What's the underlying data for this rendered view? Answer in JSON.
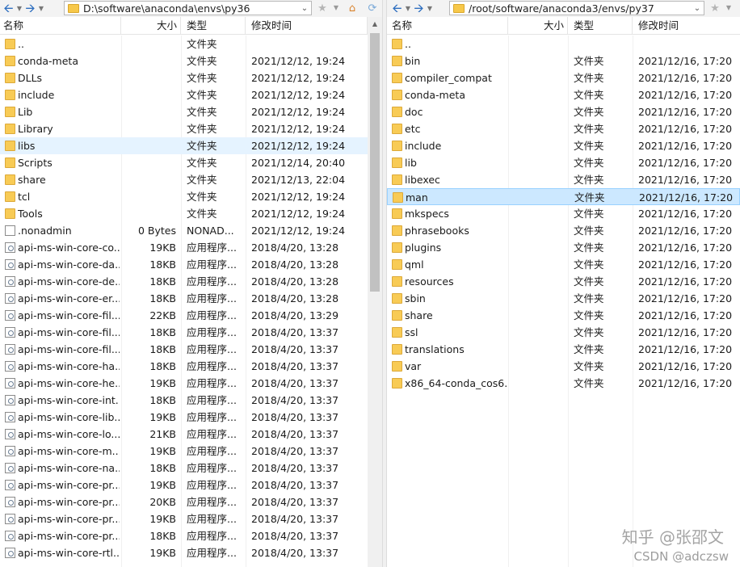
{
  "left": {
    "path": "D:\\software\\anaconda\\envs\\py36",
    "columns": {
      "name": "名称",
      "size": "大小",
      "type": "类型",
      "modified": "修改时间"
    },
    "rows": [
      {
        "name": "..",
        "size": "",
        "type": "文件夹",
        "modified": "",
        "icon": "folder"
      },
      {
        "name": "conda-meta",
        "size": "",
        "type": "文件夹",
        "modified": "2021/12/12, 19:24",
        "icon": "folder"
      },
      {
        "name": "DLLs",
        "size": "",
        "type": "文件夹",
        "modified": "2021/12/12, 19:24",
        "icon": "folder"
      },
      {
        "name": "include",
        "size": "",
        "type": "文件夹",
        "modified": "2021/12/12, 19:24",
        "icon": "folder"
      },
      {
        "name": "Lib",
        "size": "",
        "type": "文件夹",
        "modified": "2021/12/12, 19:24",
        "icon": "folder"
      },
      {
        "name": "Library",
        "size": "",
        "type": "文件夹",
        "modified": "2021/12/12, 19:24",
        "icon": "folder"
      },
      {
        "name": "libs",
        "size": "",
        "type": "文件夹",
        "modified": "2021/12/12, 19:24",
        "icon": "folder",
        "state": "hover"
      },
      {
        "name": "Scripts",
        "size": "",
        "type": "文件夹",
        "modified": "2021/12/14, 20:40",
        "icon": "folder"
      },
      {
        "name": "share",
        "size": "",
        "type": "文件夹",
        "modified": "2021/12/13, 22:04",
        "icon": "folder"
      },
      {
        "name": "tcl",
        "size": "",
        "type": "文件夹",
        "modified": "2021/12/12, 19:24",
        "icon": "folder"
      },
      {
        "name": "Tools",
        "size": "",
        "type": "文件夹",
        "modified": "2021/12/12, 19:24",
        "icon": "folder"
      },
      {
        "name": ".nonadmin",
        "size": "0 Bytes",
        "type": "NONAD...",
        "modified": "2021/12/12, 19:24",
        "icon": "file"
      },
      {
        "name": "api-ms-win-core-co...",
        "size": "19KB",
        "type": "应用程序...",
        "modified": "2018/4/20, 13:28",
        "icon": "dll"
      },
      {
        "name": "api-ms-win-core-da...",
        "size": "18KB",
        "type": "应用程序...",
        "modified": "2018/4/20, 13:28",
        "icon": "dll"
      },
      {
        "name": "api-ms-win-core-de...",
        "size": "18KB",
        "type": "应用程序...",
        "modified": "2018/4/20, 13:28",
        "icon": "dll"
      },
      {
        "name": "api-ms-win-core-er...",
        "size": "18KB",
        "type": "应用程序...",
        "modified": "2018/4/20, 13:28",
        "icon": "dll"
      },
      {
        "name": "api-ms-win-core-fil...",
        "size": "22KB",
        "type": "应用程序...",
        "modified": "2018/4/20, 13:29",
        "icon": "dll"
      },
      {
        "name": "api-ms-win-core-fil...",
        "size": "18KB",
        "type": "应用程序...",
        "modified": "2018/4/20, 13:37",
        "icon": "dll"
      },
      {
        "name": "api-ms-win-core-fil...",
        "size": "18KB",
        "type": "应用程序...",
        "modified": "2018/4/20, 13:37",
        "icon": "dll"
      },
      {
        "name": "api-ms-win-core-ha...",
        "size": "18KB",
        "type": "应用程序...",
        "modified": "2018/4/20, 13:37",
        "icon": "dll"
      },
      {
        "name": "api-ms-win-core-he...",
        "size": "19KB",
        "type": "应用程序...",
        "modified": "2018/4/20, 13:37",
        "icon": "dll"
      },
      {
        "name": "api-ms-win-core-int...",
        "size": "18KB",
        "type": "应用程序...",
        "modified": "2018/4/20, 13:37",
        "icon": "dll"
      },
      {
        "name": "api-ms-win-core-lib...",
        "size": "19KB",
        "type": "应用程序...",
        "modified": "2018/4/20, 13:37",
        "icon": "dll"
      },
      {
        "name": "api-ms-win-core-lo...",
        "size": "21KB",
        "type": "应用程序...",
        "modified": "2018/4/20, 13:37",
        "icon": "dll"
      },
      {
        "name": "api-ms-win-core-m...",
        "size": "19KB",
        "type": "应用程序...",
        "modified": "2018/4/20, 13:37",
        "icon": "dll"
      },
      {
        "name": "api-ms-win-core-na...",
        "size": "18KB",
        "type": "应用程序...",
        "modified": "2018/4/20, 13:37",
        "icon": "dll"
      },
      {
        "name": "api-ms-win-core-pr...",
        "size": "19KB",
        "type": "应用程序...",
        "modified": "2018/4/20, 13:37",
        "icon": "dll"
      },
      {
        "name": "api-ms-win-core-pr...",
        "size": "20KB",
        "type": "应用程序...",
        "modified": "2018/4/20, 13:37",
        "icon": "dll"
      },
      {
        "name": "api-ms-win-core-pr...",
        "size": "19KB",
        "type": "应用程序...",
        "modified": "2018/4/20, 13:37",
        "icon": "dll"
      },
      {
        "name": "api-ms-win-core-pr...",
        "size": "18KB",
        "type": "应用程序...",
        "modified": "2018/4/20, 13:37",
        "icon": "dll"
      },
      {
        "name": "api-ms-win-core-rtl...",
        "size": "19KB",
        "type": "应用程序...",
        "modified": "2018/4/20, 13:37",
        "icon": "dll"
      }
    ]
  },
  "right": {
    "path": "/root/software/anaconda3/envs/py37",
    "columns": {
      "name": "名称",
      "size": "大小",
      "type": "类型",
      "modified": "修改时间"
    },
    "rows": [
      {
        "name": "..",
        "size": "",
        "type": "",
        "modified": "",
        "icon": "folder"
      },
      {
        "name": "bin",
        "size": "",
        "type": "文件夹",
        "modified": "2021/12/16, 17:20",
        "icon": "folder"
      },
      {
        "name": "compiler_compat",
        "size": "",
        "type": "文件夹",
        "modified": "2021/12/16, 17:20",
        "icon": "folder"
      },
      {
        "name": "conda-meta",
        "size": "",
        "type": "文件夹",
        "modified": "2021/12/16, 17:20",
        "icon": "folder"
      },
      {
        "name": "doc",
        "size": "",
        "type": "文件夹",
        "modified": "2021/12/16, 17:20",
        "icon": "folder"
      },
      {
        "name": "etc",
        "size": "",
        "type": "文件夹",
        "modified": "2021/12/16, 17:20",
        "icon": "folder"
      },
      {
        "name": "include",
        "size": "",
        "type": "文件夹",
        "modified": "2021/12/16, 17:20",
        "icon": "folder"
      },
      {
        "name": "lib",
        "size": "",
        "type": "文件夹",
        "modified": "2021/12/16, 17:20",
        "icon": "folder"
      },
      {
        "name": "libexec",
        "size": "",
        "type": "文件夹",
        "modified": "2021/12/16, 17:20",
        "icon": "folder"
      },
      {
        "name": "man",
        "size": "",
        "type": "文件夹",
        "modified": "2021/12/16, 17:20",
        "icon": "folder",
        "state": "active"
      },
      {
        "name": "mkspecs",
        "size": "",
        "type": "文件夹",
        "modified": "2021/12/16, 17:20",
        "icon": "folder"
      },
      {
        "name": "phrasebooks",
        "size": "",
        "type": "文件夹",
        "modified": "2021/12/16, 17:20",
        "icon": "folder"
      },
      {
        "name": "plugins",
        "size": "",
        "type": "文件夹",
        "modified": "2021/12/16, 17:20",
        "icon": "folder"
      },
      {
        "name": "qml",
        "size": "",
        "type": "文件夹",
        "modified": "2021/12/16, 17:20",
        "icon": "folder"
      },
      {
        "name": "resources",
        "size": "",
        "type": "文件夹",
        "modified": "2021/12/16, 17:20",
        "icon": "folder"
      },
      {
        "name": "sbin",
        "size": "",
        "type": "文件夹",
        "modified": "2021/12/16, 17:20",
        "icon": "folder"
      },
      {
        "name": "share",
        "size": "",
        "type": "文件夹",
        "modified": "2021/12/16, 17:20",
        "icon": "folder"
      },
      {
        "name": "ssl",
        "size": "",
        "type": "文件夹",
        "modified": "2021/12/16, 17:20",
        "icon": "folder"
      },
      {
        "name": "translations",
        "size": "",
        "type": "文件夹",
        "modified": "2021/12/16, 17:20",
        "icon": "folder"
      },
      {
        "name": "var",
        "size": "",
        "type": "文件夹",
        "modified": "2021/12/16, 17:20",
        "icon": "folder"
      },
      {
        "name": "x86_64-conda_cos6...",
        "size": "",
        "type": "文件夹",
        "modified": "2021/12/16, 17:20",
        "icon": "folder"
      }
    ]
  },
  "watermark": {
    "zhihu": "知乎 @张邵文",
    "csdn": "CSDN @adczsw"
  },
  "colors": {
    "folder": "#f8cb55",
    "selection": "#cce8ff",
    "hover": "#e5f3ff",
    "nav_arrow": "#2f6fc0"
  }
}
